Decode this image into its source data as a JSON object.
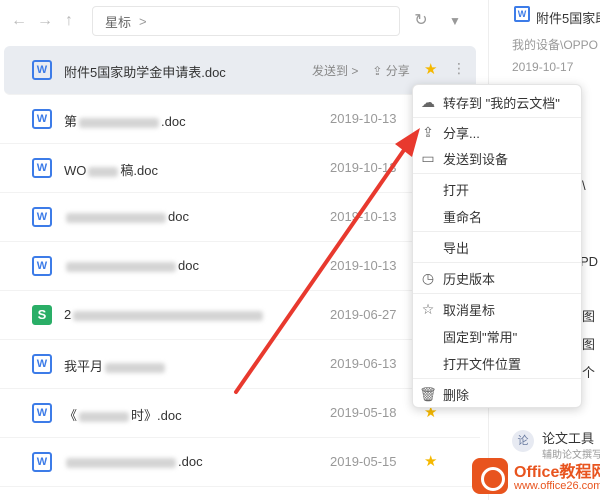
{
  "toolbar": {
    "back_icon": "←",
    "forward_icon": "→",
    "up_icon": "↑",
    "breadcrumb": "星标",
    "breadcrumb_sep": ">",
    "refresh_icon": "↻",
    "filter_icon": "▼"
  },
  "files": [
    {
      "name": "附件5国家助学金申请表.doc",
      "date": "",
      "type": "doc",
      "starred": true,
      "selected": true,
      "send_label": "发送到 >",
      "share_label": "分享"
    },
    {
      "name_prefix": "第",
      "name_suffix": ".doc",
      "date": "2019-10-13",
      "type": "doc"
    },
    {
      "name_prefix": "WO",
      "name_suffix": "稿.doc",
      "date": "2019-10-13",
      "type": "doc"
    },
    {
      "name_prefix": "",
      "name_suffix": "doc",
      "date": "2019-10-13",
      "type": "doc"
    },
    {
      "name_prefix": "",
      "name_suffix": "doc",
      "date": "2019-10-13",
      "type": "doc"
    },
    {
      "name_prefix": "2",
      "name_suffix": "",
      "date": "2019-06-27",
      "type": "sheet"
    },
    {
      "name_prefix": "我平月",
      "name_suffix": "",
      "date": "2019-06-13",
      "type": "doc"
    },
    {
      "name_prefix": "《",
      "name_suffix": "时》.doc",
      "date": "2019-05-18",
      "type": "doc",
      "starred": true
    },
    {
      "name_prefix": "",
      "name_suffix": ".doc",
      "date": "2019-05-15",
      "type": "doc",
      "starred": true
    }
  ],
  "file_icons": {
    "doc": "W",
    "sheet": "S"
  },
  "star_icon": "★",
  "more_icon": "⋮",
  "share_icon": "⇪",
  "context_menu": {
    "items": [
      {
        "label": "转存到 \"我的云文档\"",
        "icon": "☁"
      },
      {
        "label": "分享...",
        "icon": "⇪"
      },
      {
        "label": "发送到设备",
        "icon": "▭"
      },
      {
        "label": "打开",
        "icon": ""
      },
      {
        "label": "重命名",
        "icon": ""
      },
      {
        "label": "导出",
        "icon": ""
      },
      {
        "label": "历史版本",
        "icon": "◷"
      },
      {
        "label": "取消星标",
        "icon": "☆"
      },
      {
        "label": "固定到\"常用\"",
        "icon": ""
      },
      {
        "label": "打开文件位置",
        "icon": ""
      },
      {
        "label": "删除",
        "icon": "🗑"
      }
    ]
  },
  "detail_panel": {
    "title": "附件5国家助",
    "location": "我的设备\\OPPO",
    "date": "2019-10-17",
    "fragment_1": "\\",
    "fragment_2": "PD",
    "fragment_3": "图",
    "fragment_4": "图",
    "fragment_5": "个",
    "tool_title": "论文工具",
    "tool_subtitle": "辅助论文撰写",
    "tool_icon": "论"
  },
  "watermark": {
    "title": "Office教程网",
    "url": "www.office26.com"
  },
  "colors": {
    "accent": "#3d7ce8",
    "star": "#f5b800",
    "arrow": "#e8392e",
    "watermark": "#e8541e",
    "selected_row": "#e9ecf1"
  }
}
